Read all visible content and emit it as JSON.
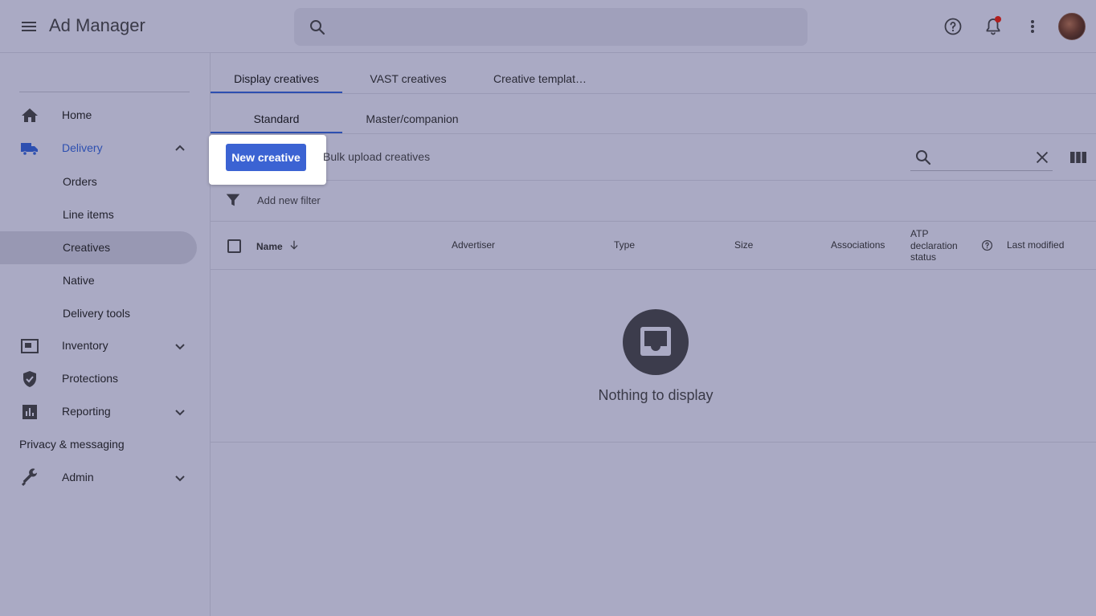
{
  "header": {
    "app_title": "Ad Manager",
    "search_placeholder": "",
    "icons": [
      "menu-icon",
      "search-icon",
      "help-icon",
      "notifications-icon",
      "more-vert-icon",
      "avatar"
    ]
  },
  "sidebar": {
    "items": [
      {
        "label": "Home",
        "icon": "home-icon"
      },
      {
        "label": "Delivery",
        "icon": "truck-icon",
        "expanded": true
      },
      {
        "label": "Orders"
      },
      {
        "label": "Line items"
      },
      {
        "label": "Creatives",
        "active": true
      },
      {
        "label": "Native"
      },
      {
        "label": "Delivery tools"
      },
      {
        "label": "Inventory",
        "icon": "inventory-icon"
      },
      {
        "label": "Protections",
        "icon": "shield-icon"
      },
      {
        "label": "Reporting",
        "icon": "bar-chart-icon"
      },
      {
        "label": "Privacy & messaging"
      },
      {
        "label": "Admin",
        "icon": "wrench-icon"
      }
    ]
  },
  "tabs": {
    "primary": [
      {
        "label": "Display creatives",
        "active": true
      },
      {
        "label": "VAST creatives"
      },
      {
        "label": "Creative templat…"
      }
    ],
    "secondary": [
      {
        "label": "Standard",
        "active": true
      },
      {
        "label": "Master/companion"
      }
    ]
  },
  "toolbar": {
    "new_creative": "New creative",
    "bulk_upload": "Bulk upload creatives",
    "search_placeholder": ""
  },
  "filter": {
    "label": "Add new filter"
  },
  "table": {
    "columns": {
      "name": "Name",
      "advertiser": "Advertiser",
      "type": "Type",
      "size": "Size",
      "associations": "Associations",
      "atp_line1": "ATP",
      "atp_line2": "declaration",
      "atp_line3": "status",
      "last_modified": "Last modified"
    },
    "sort_column": "Name",
    "sort_direction": "descending"
  },
  "empty_state": {
    "message": "Nothing to display"
  },
  "colors": {
    "accent": "#3b63d3",
    "active_nav_text": "#2d4fb0",
    "overlay_bg": "#aaaac4",
    "notification_dot": "#b21f1f"
  }
}
